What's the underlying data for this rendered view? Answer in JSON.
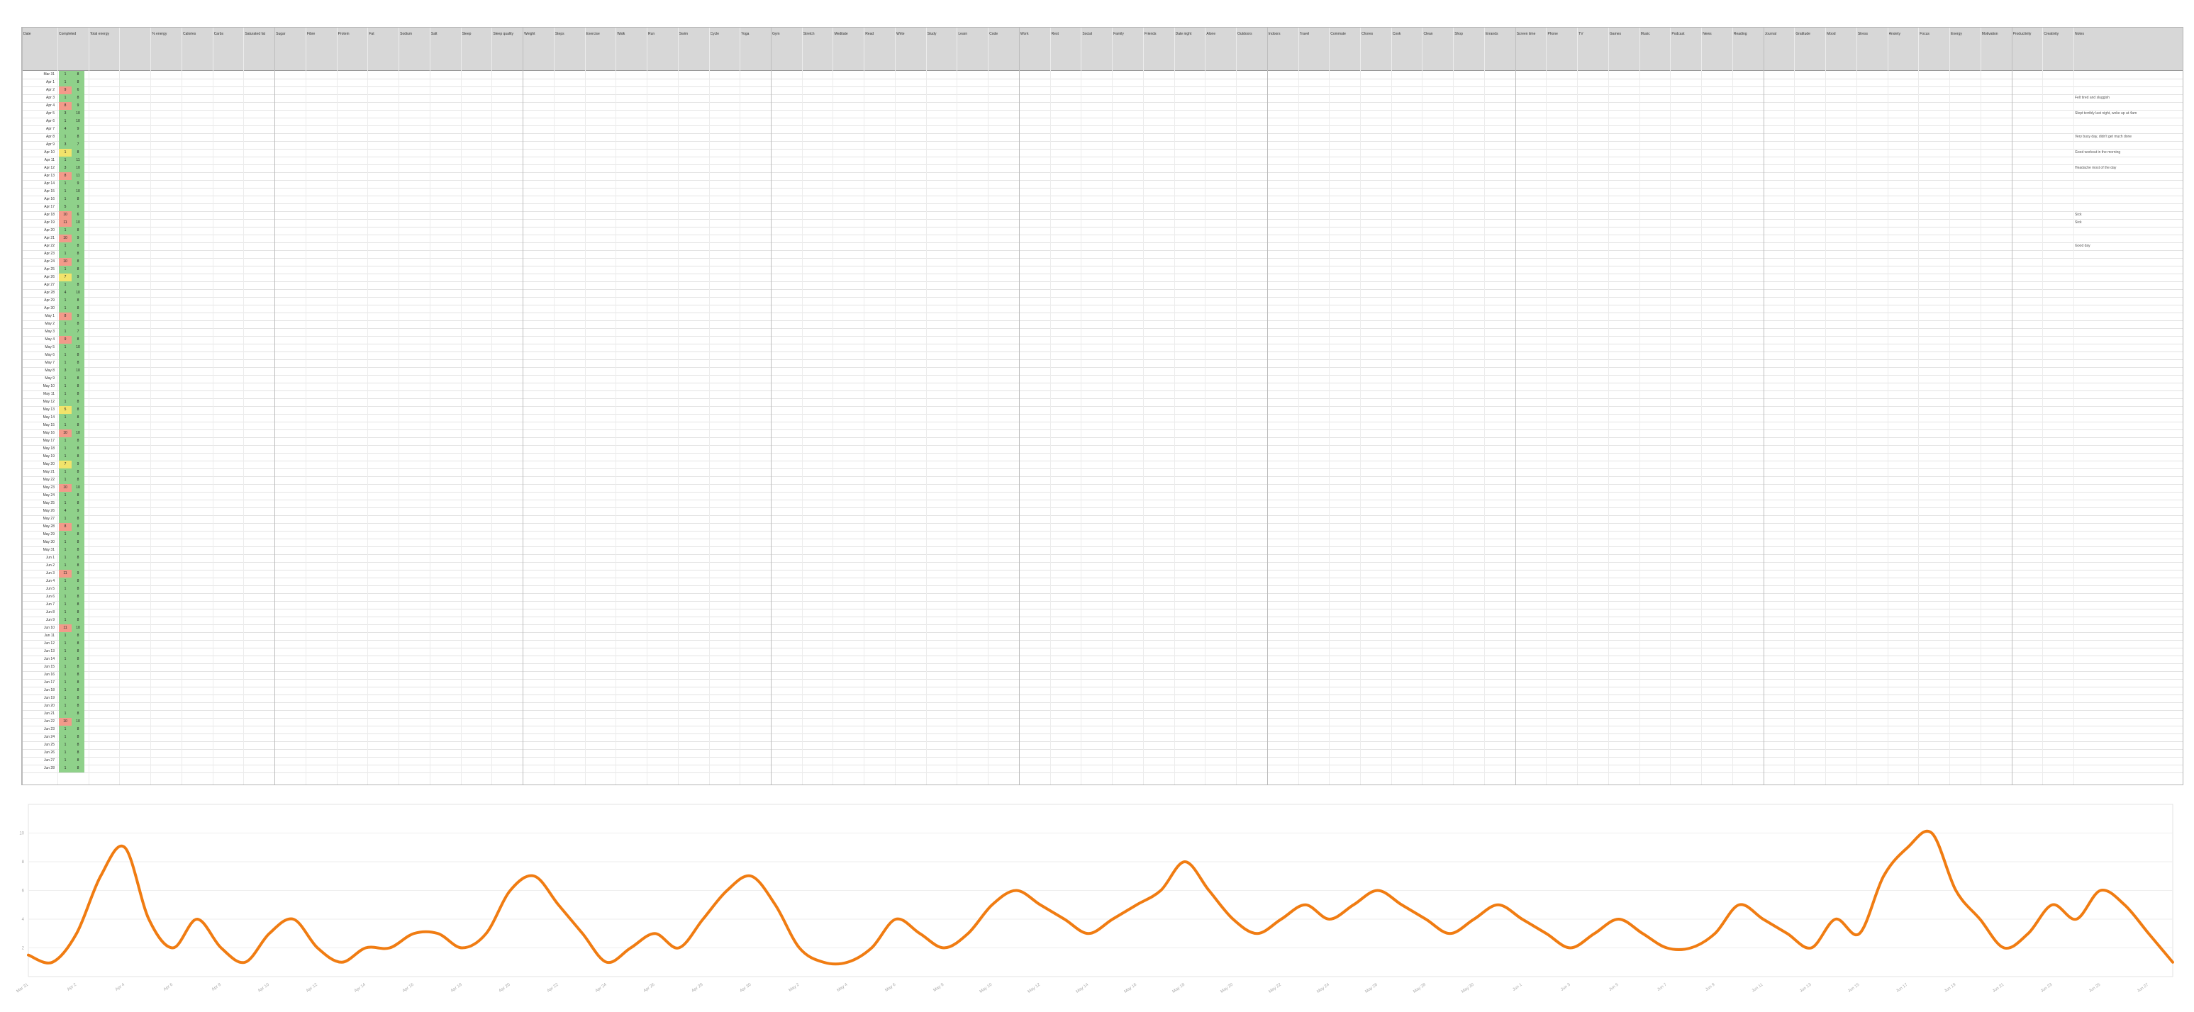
{
  "sheet": {
    "columns": [
      "Date",
      "Completed",
      "Total energy",
      "",
      "% energy",
      "Calories",
      "Carbs",
      "Saturated fat",
      "Sugar",
      "Fibre",
      "Protein",
      "Fat",
      "Sodium",
      "Salt",
      "Sleep",
      "Sleep quality",
      "Weight",
      "Steps",
      "Exercise",
      "Walk",
      "Run",
      "Swim",
      "Cycle",
      "Yoga",
      "Gym",
      "Stretch",
      "Meditate",
      "Read",
      "Write",
      "Study",
      "Learn",
      "Code",
      "Work",
      "Rest",
      "Social",
      "Family",
      "Friends",
      "Date night",
      "Alone",
      "Outdoors",
      "Indoors",
      "Travel",
      "Commute",
      "Chores",
      "Cook",
      "Clean",
      "Shop",
      "Errands",
      "Screen time",
      "Phone",
      "TV",
      "Games",
      "Music",
      "Podcast",
      "News",
      "Reading",
      "Journal",
      "Gratitude",
      "Mood",
      "Stress",
      "Anxiety",
      "Focus",
      "Energy",
      "Motivation",
      "Productivity",
      "Creativity",
      "Notes"
    ],
    "rows": [
      {
        "date": "Mar 31",
        "c1": "1",
        "c2": "8",
        "status": "green",
        "note": ""
      },
      {
        "date": "Apr 1",
        "c1": "1",
        "c2": "8",
        "status": "green",
        "note": ""
      },
      {
        "date": "Apr 2",
        "c1": "9",
        "c2": "6",
        "status": "red",
        "note": ""
      },
      {
        "date": "Apr 3",
        "c1": "1",
        "c2": "8",
        "status": "green",
        "note": "Felt tired and sluggish"
      },
      {
        "date": "Apr 4",
        "c1": "8",
        "c2": "9",
        "status": "red",
        "note": ""
      },
      {
        "date": "Apr 5",
        "c1": "3",
        "c2": "10",
        "status": "green",
        "note": "Slept terribly last night, woke up at 4am"
      },
      {
        "date": "Apr 6",
        "c1": "1",
        "c2": "10",
        "status": "green",
        "note": ""
      },
      {
        "date": "Apr 7",
        "c1": "4",
        "c2": "9",
        "status": "green",
        "note": ""
      },
      {
        "date": "Apr 8",
        "c1": "1",
        "c2": "8",
        "status": "green",
        "note": "Very busy day, didn't get much done"
      },
      {
        "date": "Apr 9",
        "c1": "3",
        "c2": "7",
        "status": "green",
        "note": ""
      },
      {
        "date": "Apr 10",
        "c1": "1",
        "c2": "8",
        "status": "yellow",
        "note": "Good workout in the morning"
      },
      {
        "date": "Apr 11",
        "c1": "1",
        "c2": "11",
        "status": "green",
        "note": ""
      },
      {
        "date": "Apr 12",
        "c1": "3",
        "c2": "10",
        "status": "green",
        "note": "Headache most of the day"
      },
      {
        "date": "Apr 13",
        "c1": "8",
        "c2": "11",
        "status": "red",
        "note": ""
      },
      {
        "date": "Apr 14",
        "c1": "1",
        "c2": "9",
        "status": "green",
        "note": ""
      },
      {
        "date": "Apr 15",
        "c1": "1",
        "c2": "10",
        "status": "green",
        "note": ""
      },
      {
        "date": "Apr 16",
        "c1": "1",
        "c2": "8",
        "status": "green",
        "note": ""
      },
      {
        "date": "Apr 17",
        "c1": "5",
        "c2": "9",
        "status": "green",
        "note": ""
      },
      {
        "date": "Apr 18",
        "c1": "10",
        "c2": "6",
        "status": "red",
        "note": "Sick"
      },
      {
        "date": "Apr 19",
        "c1": "11",
        "c2": "10",
        "status": "red",
        "note": "Sick"
      },
      {
        "date": "Apr 20",
        "c1": "1",
        "c2": "8",
        "status": "green",
        "note": ""
      },
      {
        "date": "Apr 21",
        "c1": "10",
        "c2": "9",
        "status": "red",
        "note": ""
      },
      {
        "date": "Apr 22",
        "c1": "1",
        "c2": "8",
        "status": "green",
        "note": "Good day"
      },
      {
        "date": "Apr 23",
        "c1": "1",
        "c2": "8",
        "status": "green",
        "note": ""
      },
      {
        "date": "Apr 24",
        "c1": "10",
        "c2": "8",
        "status": "red",
        "note": ""
      },
      {
        "date": "Apr 25",
        "c1": "1",
        "c2": "8",
        "status": "green",
        "note": ""
      },
      {
        "date": "Apr 26",
        "c1": "7",
        "c2": "9",
        "status": "yellow",
        "note": ""
      },
      {
        "date": "Apr 27",
        "c1": "1",
        "c2": "8",
        "status": "green",
        "note": ""
      },
      {
        "date": "Apr 28",
        "c1": "4",
        "c2": "10",
        "status": "green",
        "note": ""
      },
      {
        "date": "Apr 29",
        "c1": "1",
        "c2": "8",
        "status": "green",
        "note": ""
      },
      {
        "date": "Apr 30",
        "c1": "1",
        "c2": "8",
        "status": "green",
        "note": ""
      },
      {
        "date": "May 1",
        "c1": "8",
        "c2": "9",
        "status": "red",
        "note": ""
      },
      {
        "date": "May 2",
        "c1": "1",
        "c2": "8",
        "status": "green",
        "note": ""
      },
      {
        "date": "May 3",
        "c1": "1",
        "c2": "7",
        "status": "green",
        "note": ""
      },
      {
        "date": "May 4",
        "c1": "9",
        "c2": "8",
        "status": "red",
        "note": ""
      },
      {
        "date": "May 5",
        "c1": "1",
        "c2": "10",
        "status": "green",
        "note": ""
      },
      {
        "date": "May 6",
        "c1": "1",
        "c2": "8",
        "status": "green",
        "note": ""
      },
      {
        "date": "May 7",
        "c1": "1",
        "c2": "8",
        "status": "green",
        "note": ""
      },
      {
        "date": "May 8",
        "c1": "3",
        "c2": "10",
        "status": "green",
        "note": ""
      },
      {
        "date": "May 9",
        "c1": "1",
        "c2": "8",
        "status": "green",
        "note": ""
      },
      {
        "date": "May 10",
        "c1": "1",
        "c2": "8",
        "status": "green",
        "note": ""
      },
      {
        "date": "May 11",
        "c1": "1",
        "c2": "8",
        "status": "green",
        "note": ""
      },
      {
        "date": "May 12",
        "c1": "1",
        "c2": "8",
        "status": "green",
        "note": ""
      },
      {
        "date": "May 13",
        "c1": "5",
        "c2": "8",
        "status": "yellow",
        "note": ""
      },
      {
        "date": "May 14",
        "c1": "1",
        "c2": "8",
        "status": "green",
        "note": ""
      },
      {
        "date": "May 15",
        "c1": "1",
        "c2": "8",
        "status": "green",
        "note": ""
      },
      {
        "date": "May 16",
        "c1": "10",
        "c2": "10",
        "status": "red",
        "note": ""
      },
      {
        "date": "May 17",
        "c1": "1",
        "c2": "8",
        "status": "green",
        "note": ""
      },
      {
        "date": "May 18",
        "c1": "1",
        "c2": "8",
        "status": "green",
        "note": ""
      },
      {
        "date": "May 19",
        "c1": "1",
        "c2": "8",
        "status": "green",
        "note": ""
      },
      {
        "date": "May 20",
        "c1": "7",
        "c2": "9",
        "status": "yellow",
        "note": ""
      },
      {
        "date": "May 21",
        "c1": "1",
        "c2": "8",
        "status": "green",
        "note": ""
      },
      {
        "date": "May 22",
        "c1": "1",
        "c2": "8",
        "status": "green",
        "note": ""
      },
      {
        "date": "May 23",
        "c1": "10",
        "c2": "10",
        "status": "red",
        "note": ""
      },
      {
        "date": "May 24",
        "c1": "1",
        "c2": "8",
        "status": "green",
        "note": ""
      },
      {
        "date": "May 25",
        "c1": "1",
        "c2": "8",
        "status": "green",
        "note": ""
      },
      {
        "date": "May 26",
        "c1": "4",
        "c2": "9",
        "status": "green",
        "note": ""
      },
      {
        "date": "May 27",
        "c1": "1",
        "c2": "8",
        "status": "green",
        "note": ""
      },
      {
        "date": "May 28",
        "c1": "8",
        "c2": "8",
        "status": "red",
        "note": ""
      },
      {
        "date": "May 29",
        "c1": "1",
        "c2": "8",
        "status": "green",
        "note": ""
      },
      {
        "date": "May 30",
        "c1": "1",
        "c2": "8",
        "status": "green",
        "note": ""
      },
      {
        "date": "May 31",
        "c1": "1",
        "c2": "8",
        "status": "green",
        "note": ""
      },
      {
        "date": "Jun 1",
        "c1": "1",
        "c2": "8",
        "status": "green",
        "note": ""
      },
      {
        "date": "Jun 2",
        "c1": "1",
        "c2": "8",
        "status": "green",
        "note": ""
      },
      {
        "date": "Jun 3",
        "c1": "11",
        "c2": "9",
        "status": "red",
        "note": ""
      },
      {
        "date": "Jun 4",
        "c1": "1",
        "c2": "8",
        "status": "green",
        "note": ""
      },
      {
        "date": "Jun 5",
        "c1": "1",
        "c2": "8",
        "status": "green",
        "note": ""
      },
      {
        "date": "Jun 6",
        "c1": "1",
        "c2": "8",
        "status": "green",
        "note": ""
      },
      {
        "date": "Jun 7",
        "c1": "1",
        "c2": "8",
        "status": "green",
        "note": ""
      },
      {
        "date": "Jun 8",
        "c1": "1",
        "c2": "8",
        "status": "green",
        "note": ""
      },
      {
        "date": "Jun 9",
        "c1": "1",
        "c2": "8",
        "status": "green",
        "note": ""
      },
      {
        "date": "Jun 10",
        "c1": "11",
        "c2": "10",
        "status": "red",
        "note": ""
      },
      {
        "date": "Jun 11",
        "c1": "1",
        "c2": "8",
        "status": "green",
        "note": ""
      },
      {
        "date": "Jun 12",
        "c1": "1",
        "c2": "8",
        "status": "green",
        "note": ""
      },
      {
        "date": "Jun 13",
        "c1": "1",
        "c2": "8",
        "status": "green",
        "note": ""
      },
      {
        "date": "Jun 14",
        "c1": "1",
        "c2": "8",
        "status": "green",
        "note": ""
      },
      {
        "date": "Jun 15",
        "c1": "1",
        "c2": "8",
        "status": "green",
        "note": ""
      },
      {
        "date": "Jun 16",
        "c1": "1",
        "c2": "8",
        "status": "green",
        "note": ""
      },
      {
        "date": "Jun 17",
        "c1": "1",
        "c2": "8",
        "status": "green",
        "note": ""
      },
      {
        "date": "Jun 18",
        "c1": "1",
        "c2": "8",
        "status": "green",
        "note": ""
      },
      {
        "date": "Jun 19",
        "c1": "1",
        "c2": "8",
        "status": "green",
        "note": ""
      },
      {
        "date": "Jun 20",
        "c1": "1",
        "c2": "8",
        "status": "green",
        "note": ""
      },
      {
        "date": "Jun 21",
        "c1": "1",
        "c2": "8",
        "status": "green",
        "note": ""
      },
      {
        "date": "Jun 22",
        "c1": "10",
        "c2": "10",
        "status": "red",
        "note": ""
      },
      {
        "date": "Jun 23",
        "c1": "1",
        "c2": "8",
        "status": "green",
        "note": ""
      },
      {
        "date": "Jun 24",
        "c1": "1",
        "c2": "8",
        "status": "green",
        "note": ""
      },
      {
        "date": "Jun 25",
        "c1": "1",
        "c2": "8",
        "status": "green",
        "note": ""
      },
      {
        "date": "Jun 26",
        "c1": "1",
        "c2": "8",
        "status": "green",
        "note": ""
      },
      {
        "date": "Jun 27",
        "c1": "1",
        "c2": "8",
        "status": "green",
        "note": ""
      },
      {
        "date": "Jun 28",
        "c1": "1",
        "c2": "8",
        "status": "green",
        "note": ""
      }
    ],
    "status_colors": {
      "green": "#8fd18a",
      "yellow": "#f2e36b",
      "red": "#f29a8a"
    }
  },
  "chart_data": {
    "type": "line",
    "color": "#f07c12",
    "ylim": [
      0,
      12
    ],
    "grid": true,
    "y_ticks": [
      "2",
      "4",
      "6",
      "8",
      "10"
    ],
    "x": [
      "Mar 31",
      "Apr 1",
      "Apr 2",
      "Apr 3",
      "Apr 4",
      "Apr 5",
      "Apr 6",
      "Apr 7",
      "Apr 8",
      "Apr 9",
      "Apr 10",
      "Apr 11",
      "Apr 12",
      "Apr 13",
      "Apr 14",
      "Apr 15",
      "Apr 16",
      "Apr 17",
      "Apr 18",
      "Apr 19",
      "Apr 20",
      "Apr 21",
      "Apr 22",
      "Apr 23",
      "Apr 24",
      "Apr 25",
      "Apr 26",
      "Apr 27",
      "Apr 28",
      "Apr 29",
      "Apr 30",
      "May 1",
      "May 2",
      "May 3",
      "May 4",
      "May 5",
      "May 6",
      "May 7",
      "May 8",
      "May 9",
      "May 10",
      "May 11",
      "May 12",
      "May 13",
      "May 14",
      "May 15",
      "May 16",
      "May 17",
      "May 18",
      "May 19",
      "May 20",
      "May 21",
      "May 22",
      "May 23",
      "May 24",
      "May 25",
      "May 26",
      "May 27",
      "May 28",
      "May 29",
      "May 30",
      "May 31",
      "Jun 1",
      "Jun 2",
      "Jun 3",
      "Jun 4",
      "Jun 5",
      "Jun 6",
      "Jun 7",
      "Jun 8",
      "Jun 9",
      "Jun 10",
      "Jun 11",
      "Jun 12",
      "Jun 13",
      "Jun 14",
      "Jun 15",
      "Jun 16",
      "Jun 17",
      "Jun 18",
      "Jun 19",
      "Jun 20",
      "Jun 21",
      "Jun 22",
      "Jun 23",
      "Jun 24",
      "Jun 25",
      "Jun 26",
      "Jun 27",
      "Jun 28"
    ],
    "series": [
      {
        "values": [
          1.5,
          1,
          3,
          7,
          9,
          4,
          2,
          4,
          2,
          1,
          3,
          4,
          2,
          1,
          2,
          2,
          3,
          3,
          2,
          3,
          6,
          7,
          5,
          3,
          1,
          2,
          3,
          2,
          4,
          6,
          7,
          5,
          2,
          1,
          1,
          2,
          4,
          3,
          2,
          3,
          5,
          6,
          5,
          4,
          3,
          4,
          5,
          6,
          8,
          6,
          4,
          3,
          4,
          5,
          4,
          5,
          6,
          5,
          4,
          3,
          4,
          5,
          4,
          3,
          2,
          3,
          4,
          3,
          2,
          2,
          3,
          5,
          4,
          3,
          2,
          4,
          3,
          7,
          9,
          10,
          6,
          4,
          2,
          3,
          5,
          4,
          6,
          5,
          3,
          1
        ]
      }
    ]
  }
}
